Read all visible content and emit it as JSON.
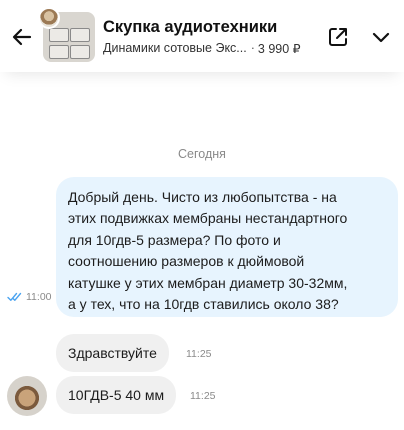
{
  "header": {
    "title": "Скупка аудиотехники",
    "item_name": "Динамики сотовые Экс...",
    "separator": "·",
    "price": "3 990 ₽",
    "icons": [
      "back-arrow-icon",
      "external-link-icon",
      "chevron-down-icon"
    ]
  },
  "chat": {
    "date_label": "Сегодня",
    "outgoing": {
      "lines": [
        "Добрый день. Чисто из любопытства - на",
        "этих подвижках мембраны нестандартного",
        "для 10гдв-5 размера? По фото и",
        "соотношению размеров к дюймовой",
        "катушке у этих мембран диаметр 30-32мм,",
        "а у тех, что на 10гдв ставились около 38?"
      ],
      "time": "11:00",
      "status_icon": "double-check-icon"
    },
    "incoming": [
      {
        "text": "Здравствуйте",
        "time": "11:25"
      },
      {
        "text": "10ГДВ-5 40 мм",
        "time": "11:25"
      }
    ]
  },
  "colors": {
    "outgoing_bubble": "#e7f4fe",
    "incoming_bubble": "#f0f0f0",
    "read_check": "#4aa3f0"
  }
}
